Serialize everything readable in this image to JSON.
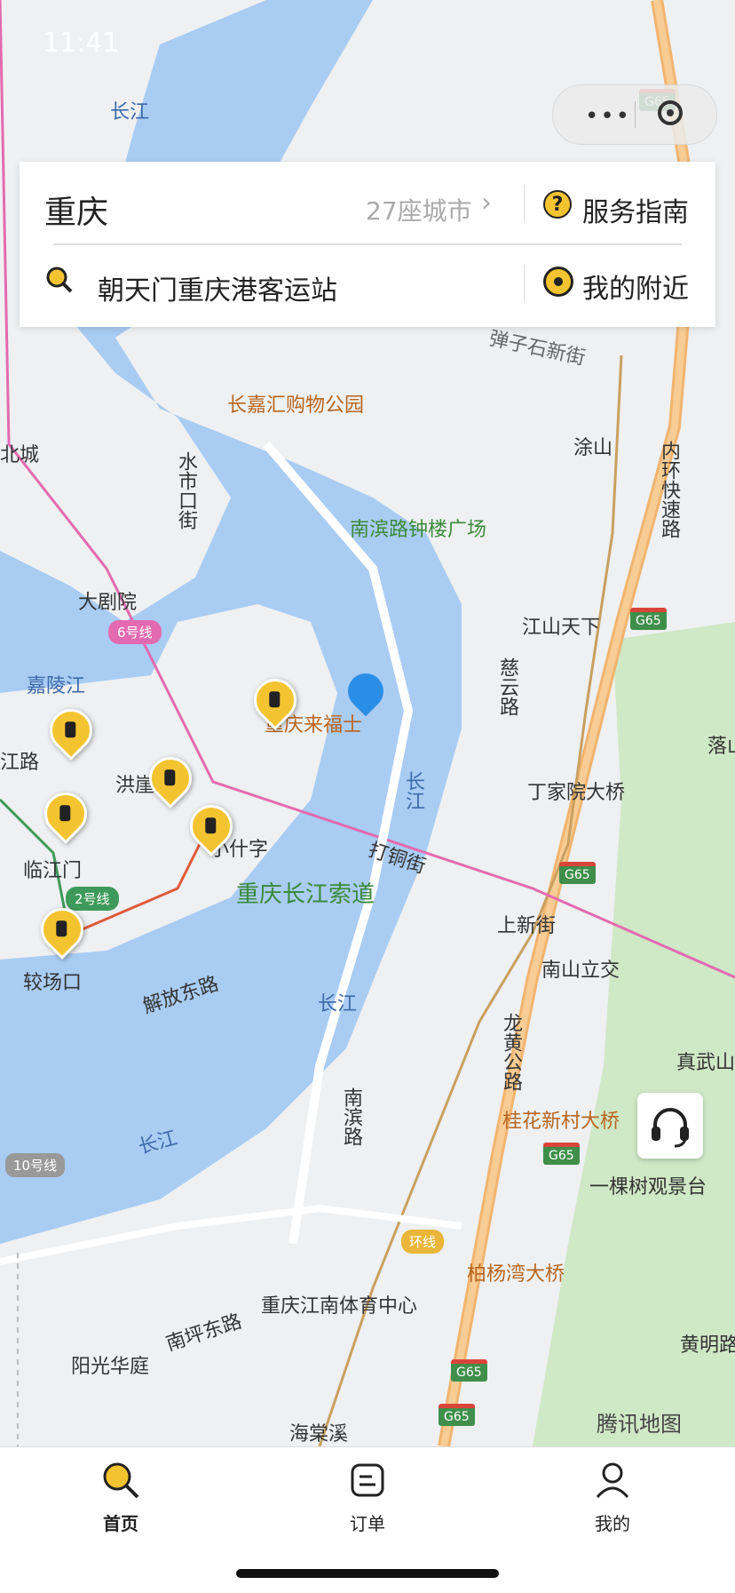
{
  "status_bar": {
    "time": "11:41"
  },
  "header": {
    "city": "重庆",
    "city_count": "27座城市",
    "guide_label": "服务指南",
    "search_text": "朝天门重庆港客运站",
    "nearby_label": "我的附近"
  },
  "map": {
    "labels": {
      "changjiang_1": "长江",
      "changjiang_2": "长江",
      "changjiang_3": "长江",
      "changjiang_4": "长江",
      "jialingjiang": "嘉陵江",
      "changjiahui": "长嘉汇购物公园",
      "nanbinlu": "南滨路钟楼广场",
      "tushan": "涂山",
      "jiangshan": "江山天下",
      "danzishi": "弹子石新街",
      "neihuan": "内环快速路",
      "shuishikou": "水市口街",
      "beicheng": "北城",
      "dajuyuan": "大剧院",
      "line6": "6号线",
      "laifushi": "重庆来福士",
      "hongyadong": "洪崖",
      "xiaoshizi": "小什字",
      "jiefangdonglu": "解放东路",
      "jiaochangkou": "较场口",
      "linjiangmen": "临江门",
      "line2": "2号线",
      "suodao": "重庆长江索道",
      "dadongjie": "打铜街",
      "shangxinjie": "上新街",
      "dingjiayuan": "丁家院大桥",
      "nanshanlijiao": "南山立交",
      "cishilu": "慈云路",
      "longhuanggonglu": "龙黄公路",
      "guihuaxincun": "桂花新村大桥",
      "yikeshu": "一棵树观景台",
      "zhenwushan": "真武山",
      "nanbinlu2": "南滨路",
      "huanxian1": "环线",
      "huanxian2": "环线",
      "baiyangwan": "柏杨湾大桥",
      "jiangnantiyu": "重庆江南体育中心",
      "nanpingdonglu": "南坪东路",
      "yangguanghuating": "阳光华庭",
      "haitangxi": "海棠溪",
      "huangjuelu": "黄明路",
      "line10": "10号线",
      "g65": "G65",
      "jianglu": "江路",
      "huan": "环",
      "luoshan": "落山",
      "huanxian_small": "环线"
    }
  },
  "tabbar": {
    "home": "首页",
    "orders": "订单",
    "mine": "我的"
  },
  "brand": "腾讯地图"
}
